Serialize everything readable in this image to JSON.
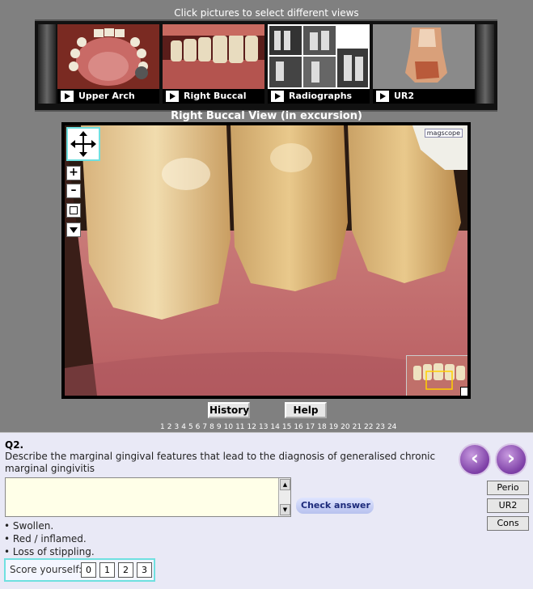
{
  "instruction": "Click pictures to select different views",
  "thumbnails": [
    {
      "label": "Upper Arch",
      "icon": "play-icon"
    },
    {
      "label": "Right Buccal",
      "icon": "play-icon"
    },
    {
      "label": "Radiographs",
      "icon": "play-icon"
    },
    {
      "label": "UR2",
      "icon": "play-icon"
    }
  ],
  "view_title": "Right Buccal View (in excursion)",
  "viewer": {
    "brand": "magscope",
    "zoom_in": "+",
    "zoom_out": "–",
    "pan_icon": "move-arrows-icon"
  },
  "buttons": {
    "history": "History",
    "help": "Help"
  },
  "pages": [
    "1",
    "2",
    "3",
    "4",
    "5",
    "6",
    "7",
    "8",
    "9",
    "10",
    "11",
    "12",
    "13",
    "14",
    "15",
    "16",
    "17",
    "18",
    "19",
    "20",
    "21",
    "22",
    "23",
    "24"
  ],
  "question": {
    "number": "Q2.",
    "text": "Describe the marginal gingival features that lead to the diagnosis of generalised chronic marginal gingivitis",
    "answer_value": "",
    "check_label": "Check answer"
  },
  "answers": [
    "• Swollen.",
    "• Red / inflamed.",
    "• Loss of stippling."
  ],
  "score": {
    "label": "Score yourself:",
    "options": [
      "0",
      "1",
      "2",
      "3"
    ]
  },
  "side_buttons": [
    "Perio",
    "UR2",
    "Cons"
  ],
  "nav": {
    "prev": "‹",
    "next": "›"
  }
}
